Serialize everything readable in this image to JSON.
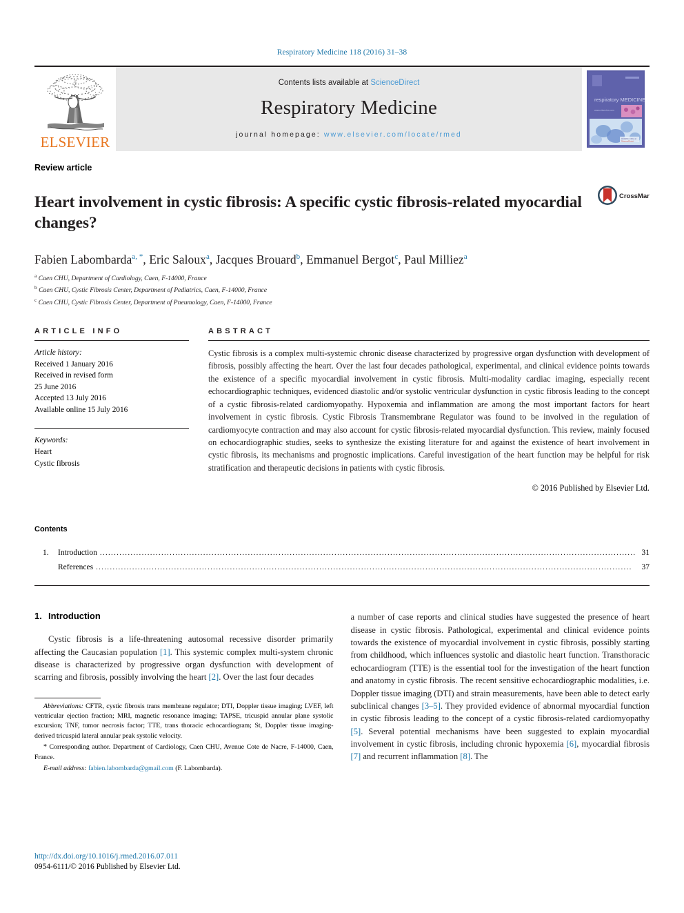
{
  "running_head": "Respiratory Medicine 118 (2016) 31–38",
  "masthead": {
    "publisher_name": "ELSEVIER",
    "publisher_logo": "elsevier-tree-logo",
    "contents_prefix": "Contents lists available at ",
    "contents_link": "ScienceDirect",
    "journal_title": "Respiratory Medicine",
    "homepage_prefix": "journal homepage: ",
    "homepage_url": "www.elsevier.com/locate/rmed",
    "cover_caption": "respiratory MEDICINE"
  },
  "article": {
    "kind": "Review article",
    "title": "Heart involvement in cystic fibrosis: A specific cystic fibrosis-related myocardial changes?",
    "crossmark_label": "CrossMark",
    "authors": [
      {
        "name": "Fabien Labombarda",
        "marks": "a, *"
      },
      {
        "name": "Eric Saloux",
        "marks": "a"
      },
      {
        "name": "Jacques Brouard",
        "marks": "b"
      },
      {
        "name": "Emmanuel Bergot",
        "marks": "c"
      },
      {
        "name": "Paul Milliez",
        "marks": "a"
      }
    ],
    "affiliations": [
      {
        "mark": "a",
        "text": "Caen CHU, Department of Cardiology, Caen, F-14000, France"
      },
      {
        "mark": "b",
        "text": "Caen CHU, Cystic Fibrosis Center, Department of Pediatrics, Caen, F-14000, France"
      },
      {
        "mark": "c",
        "text": "Caen CHU, Cystic Fibrosis Center, Department of Pneumology, Caen, F-14000, France"
      }
    ]
  },
  "info": {
    "heading": "ARTICLE INFO",
    "history_label": "Article history:",
    "history": [
      "Received 1 January 2016",
      "Received in revised form",
      "25 June 2016",
      "Accepted 13 July 2016",
      "Available online 15 July 2016"
    ],
    "keywords_label": "Keywords:",
    "keywords": [
      "Heart",
      "Cystic fibrosis"
    ]
  },
  "abstract": {
    "heading": "ABSTRACT",
    "text": "Cystic fibrosis is a complex multi-systemic chronic disease characterized by progressive organ dysfunction with development of fibrosis, possibly affecting the heart. Over the last four decades pathological, experimental, and clinical evidence points towards the existence of a specific myocardial involvement in cystic fibrosis. Multi-modality cardiac imaging, especially recent echocardiographic techniques, evidenced diastolic and/or systolic ventricular dysfunction in cystic fibrosis leading to the concept of a cystic fibrosis-related cardiomyopathy. Hypoxemia and inflammation are among the most important factors for heart involvement in cystic fibrosis. Cystic Fibrosis Transmembrane Regulator was found to be involved in the regulation of cardiomyocyte contraction and may also account for cystic fibrosis-related myocardial dysfunction. This review, mainly focused on echocardiographic studies, seeks to synthesize the existing literature for and against the existence of heart involvement in cystic fibrosis, its mechanisms and prognostic implications. Careful investigation of the heart function may be helpful for risk stratification and therapeutic decisions in patients with cystic fibrosis.",
    "copyright": "© 2016 Published by Elsevier Ltd."
  },
  "contents": {
    "heading": "Contents",
    "entries": [
      {
        "number": "1.",
        "label": "Introduction",
        "page": "31"
      },
      {
        "number": "",
        "label": "References",
        "page": "37"
      }
    ]
  },
  "intro": {
    "heading_number": "1.",
    "heading_label": "Introduction",
    "left_para_1": "Cystic fibrosis is a life-threatening autosomal recessive disorder primarily affecting the Caucasian population ",
    "left_ref_1": "[1]",
    "left_para_2": ". This systemic complex multi-system chronic disease is characterized by progressive organ dysfunction with development of scarring and fibrosis, possibly involving the heart ",
    "left_ref_2": "[2]",
    "left_para_3": ". Over the last four decades",
    "right_para_1": "a number of case reports and clinical studies have suggested the presence of heart disease in cystic fibrosis. Pathological, experimental and clinical evidence points towards the existence of myocardial involvement in cystic fibrosis, possibly starting from childhood, which influences systolic and diastolic heart function. Transthoracic echocardiogram (TTE) is the essential tool for the investigation of the heart function and anatomy in cystic fibrosis. The recent sensitive echocardiographic modalities, i.e. Doppler tissue imaging (DTI) and strain measurements, have been able to detect early subclinical changes ",
    "right_ref_1": "[3–5]",
    "right_para_2": ". They provided evidence of abnormal myocardial function in cystic fibrosis leading to the concept of a cystic fibrosis-related cardiomyopathy ",
    "right_ref_2": "[5]",
    "right_para_3": ". Several potential mechanisms have been suggested to explain myocardial involvement in cystic fibrosis, including chronic hypoxemia ",
    "right_ref_3": "[6]",
    "right_para_4": ", myocardial fibrosis ",
    "right_ref_4": "[7]",
    "right_para_5": " and recurrent inflammation ",
    "right_ref_5": "[8]",
    "right_para_6": ". The"
  },
  "footnotes": {
    "abbrev_label": "Abbreviations:",
    "abbrev_text": " CFTR, cystic fibrosis trans membrane regulator; DTI, Doppler tissue imaging; LVEF, left ventricular ejection fraction; MRI, magnetic resonance imaging; TAPSE, tricuspid annular plane systolic excursion; TNF, tumor necrosis factor; TTE, trans thoracic echocardiogram; St, Doppler tissue imaging-derived tricuspid lateral annular peak systolic velocity.",
    "corresponding_marker": "*",
    "corresponding_text": " Corresponding author. Department of Cardiology, Caen CHU, Avenue Cote de Nacre, F-14000, Caen, France.",
    "email_label": "E-mail address:",
    "email": "fabien.labombarda@gmail.com",
    "email_suffix": " (F. Labombarda)."
  },
  "footer": {
    "doi": "http://dx.doi.org/10.1016/j.rmed.2016.07.011",
    "issn": "0954-6111/© 2016 Published by Elsevier Ltd."
  },
  "colors": {
    "link": "#1b75a8",
    "sciencedirect": "#4a9ad4",
    "elsevier_orange": "#E87722",
    "masthead_bg": "#e8e8e8"
  }
}
